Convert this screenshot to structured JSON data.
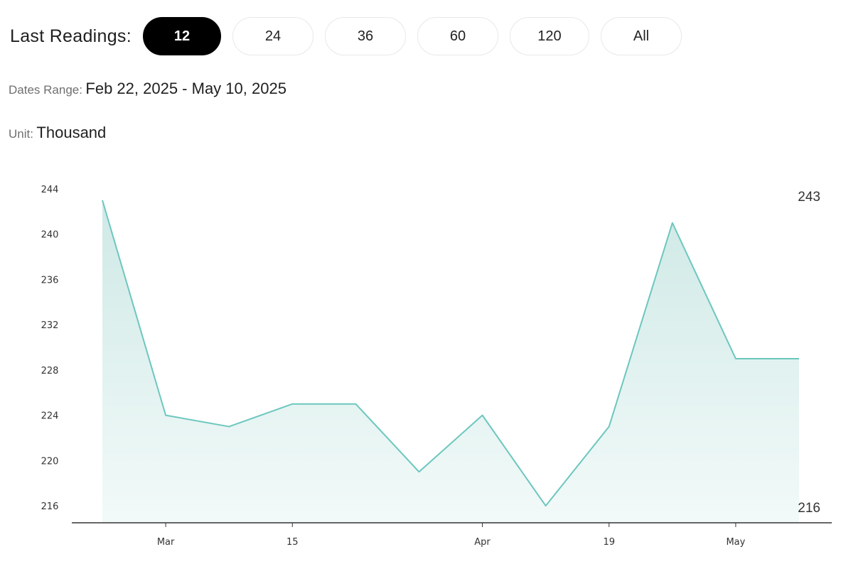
{
  "header": {
    "last_readings_label": "Last Readings:",
    "options": [
      "12",
      "24",
      "36",
      "60",
      "120",
      "All"
    ],
    "selected": "12",
    "dates_range_label": "Dates Range:",
    "dates_range_value": "Feb 22, 2025 - May 10, 2025",
    "unit_label": "Unit:",
    "unit_value": "Thousand"
  },
  "colors": {
    "line": "#6cc7be",
    "fill_top": "#cfe9e6",
    "fill_bottom": "#f2faf9",
    "axis": "#333333",
    "active_pill": "#000000"
  },
  "chart_data": {
    "type": "area",
    "x": [
      "2025-02-22",
      "2025-03-01",
      "2025-03-08",
      "2025-03-15",
      "2025-03-22",
      "2025-03-29",
      "2025-04-05",
      "2025-04-12",
      "2025-04-19",
      "2025-04-26",
      "2025-05-03",
      "2025-05-10"
    ],
    "values": [
      243,
      224,
      223,
      225,
      225,
      219,
      224,
      216,
      223,
      241,
      229,
      229
    ],
    "x_tick_labels": [
      {
        "date": "2025-03-01",
        "label": "Mar"
      },
      {
        "date": "2025-03-15",
        "label": "15"
      },
      {
        "date": "2025-04-05",
        "label": "Apr"
      },
      {
        "date": "2025-04-19",
        "label": "19"
      },
      {
        "date": "2025-05-03",
        "label": "May"
      }
    ],
    "y_ticks": [
      216,
      220,
      224,
      228,
      232,
      236,
      240,
      244
    ],
    "ylim": [
      214.5,
      245
    ],
    "max_label": "243",
    "min_label": "216",
    "grid": false
  }
}
